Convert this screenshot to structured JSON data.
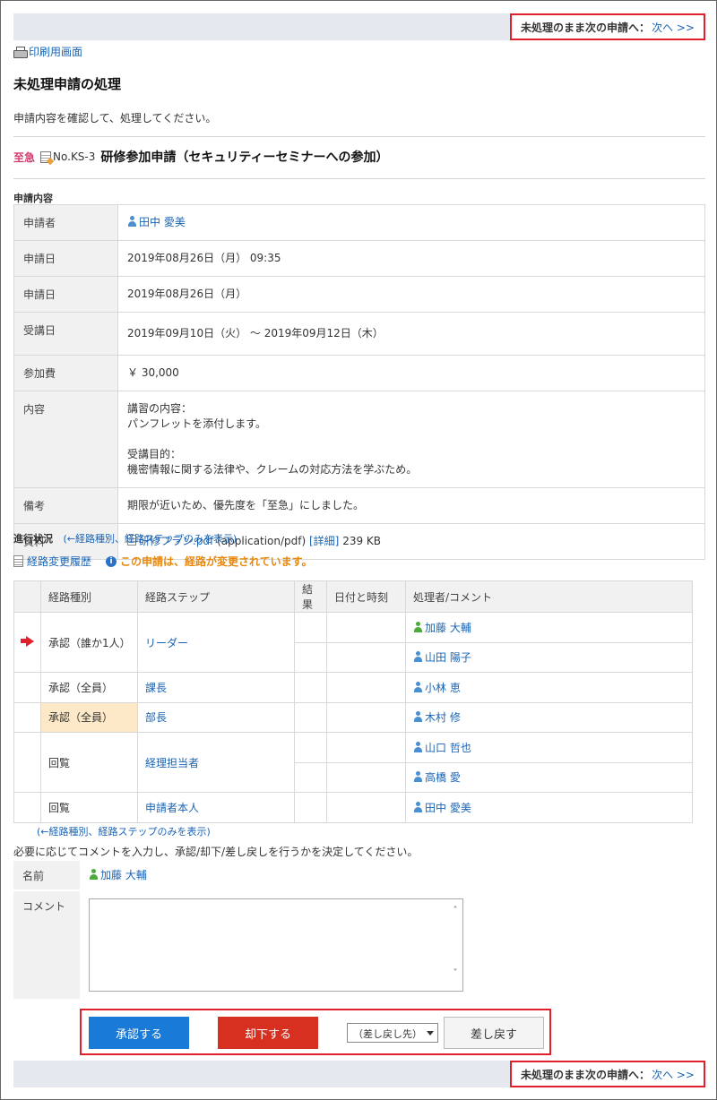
{
  "nav": {
    "next_label": "未処理のまま次の申請へ：",
    "next_link": "次へ >>"
  },
  "print_label": "印刷用画面",
  "page_title": "未処理申請の処理",
  "instruction": "申請内容を確認して、処理してください。",
  "request": {
    "priority": "至急",
    "number": "No.KS-3",
    "title": "研修参加申請（セキュリティーセミナーへの参加）"
  },
  "details_section_label": "申請内容",
  "details": {
    "applicant_label": "申請者",
    "applicant": "田中 愛美",
    "date_label": "申請日",
    "date_value": "2019年08月26日（月） 09:35",
    "date2_label": "申請日",
    "date2_value": "2019年08月26日（月）",
    "course_label": "受講日",
    "course_value": "2019年09月10日（火） ～ 2019年09月12日（木）",
    "fee_label": "参加費",
    "fee_value": "￥ 30,000",
    "content_label": "内容",
    "content_line1": "講習の内容：",
    "content_line2": "パンフレットを添付します。",
    "content_line3": "受講目的：",
    "content_line4": "機密情報に関する法律や、クレームの対応方法を学ぶため。",
    "note_label": "備考",
    "note_value": "期限が近いため、優先度を「至急」にしました。",
    "attach_label": "資料",
    "attach_file": "研修プラン.pdf",
    "attach_type": "(application/pdf)",
    "attach_detail": "[詳細]",
    "attach_size": "239 KB"
  },
  "progress": {
    "label": "進行状況",
    "toggle_link": "(←経路種別、経路ステップのみを表示)",
    "history_link": "経路変更履歴",
    "changed_notice": "この申請は、経路が変更されています。",
    "toggle_link_bottom": "(←経路種別、経路ステップのみを表示)"
  },
  "route_table": {
    "headers": [
      "経路種別",
      "経路ステップ",
      "結果",
      "日付と時刻",
      "処理者/コメント"
    ],
    "rows": {
      "r1_type": "承認（誰か1人）",
      "r1_step": "リーダー",
      "r1_user1": "加藤 大輔",
      "r1_user2": "山田 陽子",
      "r2_type": "承認（全員）",
      "r2_step": "課長",
      "r2_user": "小林 恵",
      "r3_type": "承認（全員）",
      "r3_step": "部長",
      "r3_user": "木村 修",
      "r4_type": "回覧",
      "r4_step": "経理担当者",
      "r4_user1": "山口 哲也",
      "r4_user2": "高橋 愛",
      "r5_type": "回覧",
      "r5_step": "申請者本人",
      "r5_user": "田中 愛美"
    }
  },
  "decide_text": "必要に応じてコメントを入力し、承認/却下/差し戻しを行うかを決定してください。",
  "form": {
    "name_label": "名前",
    "name_value": "加藤 大輔",
    "comment_label": "コメント",
    "comment_value": ""
  },
  "actions": {
    "approve": "承認する",
    "reject": "却下する",
    "return_select": "（差し戻し先）",
    "return": "差し戻す"
  },
  "colors": {
    "highlight_border": "#e0202c",
    "link": "#1a64b4",
    "approve": "#1a7ad8",
    "reject": "#d83020",
    "notice": "#e8880c"
  }
}
